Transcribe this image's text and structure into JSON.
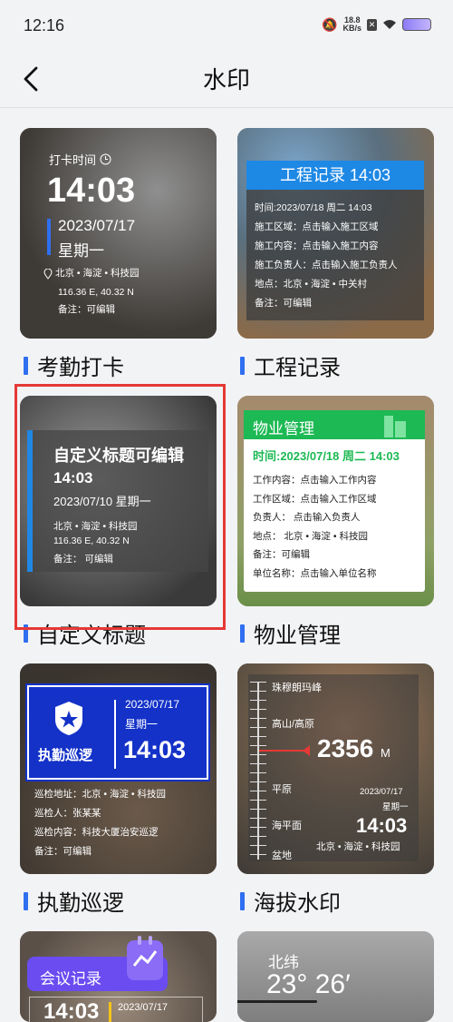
{
  "status_bar": {
    "time": "12:16",
    "speed_top": "18.8",
    "speed_bottom": "KB/s"
  },
  "header": {
    "title": "水印"
  },
  "cards": {
    "attendance": {
      "label": "考勤打卡",
      "clock_title": "打卡时间",
      "time": "14:03",
      "date": "2023/07/17",
      "weekday": "星期一",
      "location": "北京 • 海淀 • 科技园",
      "coords": "116.36 E, 40.32 N",
      "note": "备注：可编辑"
    },
    "engineering": {
      "label": "工程记录",
      "title": "工程记录 14:03",
      "lines": [
        "时间:2023/07/18 周二 14:03",
        "施工区域：点击输入施工区域",
        "施工内容：点击输入施工内容",
        "施工负责人：点击输入施工负责人",
        "地点：北京 • 海淀 • 中关村",
        "备注：可编辑"
      ]
    },
    "custom": {
      "label": "自定义标题",
      "title": "自定义标题可编辑",
      "time": "14:03",
      "date": "2023/07/10 星期一",
      "location": "北京 • 海淀 • 科技园",
      "coords": "116.36 E, 40.32 N",
      "note": "备注：  可编辑"
    },
    "property": {
      "label": "物业管理",
      "title": "物业管理",
      "time_line": "时间:2023/07/18 周二 14:03",
      "lines": [
        "工作内容：点击输入工作内容",
        "工作区域：点击输入工作区域",
        "负责人：  点击输入负责人",
        "地点：  北京 • 海淀 • 科技园",
        "备注：可编辑",
        "单位名称：点击输入单位名称"
      ]
    },
    "patrol": {
      "label": "执勤巡逻",
      "badge": "执勤巡逻",
      "date": "2023/07/17",
      "weekday": "星期一",
      "time": "14:03",
      "lines": [
        "巡检地址：北京 • 海淀 • 科技园",
        "巡检人：张某某",
        "巡检内容：科技大厦治安巡逻",
        "备注：可编辑"
      ]
    },
    "altitude": {
      "label": "海拔水印",
      "levels": [
        "珠穆朗玛峰",
        "高山/高原",
        "平原",
        "海平面",
        "盆地"
      ],
      "value": "2356",
      "unit": "M",
      "date": "2023/07/17",
      "weekday": "星期一",
      "time": "14:03",
      "location": "北京 • 海淀 • 科技园"
    },
    "meeting": {
      "title": "会议记录",
      "time": "14:03",
      "date": "2023/07/17"
    },
    "latitude": {
      "title": "北纬",
      "value": "23° 26′"
    }
  },
  "colors": {
    "accent": "#2f6ff0",
    "highlight": "#e53935",
    "engineering_blue": "#1e88e5",
    "property_green": "#1db954",
    "patrol_blue": "#1432c8",
    "meeting_purple": "#6a4cf0"
  }
}
